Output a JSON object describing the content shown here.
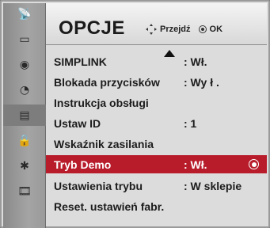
{
  "header": {
    "title": "OPCJE",
    "hint_move": "Przejdź",
    "hint_ok": "OK"
  },
  "sidebar": {
    "items": [
      {
        "icon": "satellite-dish-icon",
        "glyph": "📡"
      },
      {
        "icon": "picture-monitor-icon",
        "glyph": "▭"
      },
      {
        "icon": "audio-speaker-icon",
        "glyph": "◉"
      },
      {
        "icon": "clock-icon",
        "glyph": "◔"
      },
      {
        "icon": "options-toolbox-icon",
        "glyph": "▤"
      },
      {
        "icon": "lock-icon",
        "glyph": "🔒"
      },
      {
        "icon": "bluetooth-icon",
        "glyph": "✱"
      },
      {
        "icon": "media-film-icon",
        "glyph": "🎞"
      }
    ],
    "selected_index": 4
  },
  "menu": {
    "items": [
      {
        "label": "SIMPLINK",
        "value": ": Wł."
      },
      {
        "label": "Blokada przycisków",
        "value": ": Wy ł ."
      },
      {
        "label": "Instrukcja obsługi",
        "value": ""
      },
      {
        "label": "Ustaw ID",
        "value": ": 1"
      },
      {
        "label": "Wskaźnik zasilania",
        "value": ""
      },
      {
        "label": "Tryb Demo",
        "value": ": Wł."
      },
      {
        "label": "Ustawienia trybu",
        "value": ": W sklepie"
      },
      {
        "label": "Reset. ustawień  fabr.",
        "value": ""
      }
    ],
    "selected_index": 5
  },
  "colors": {
    "selection": "#b81c2b",
    "header_bg": "#e8e8e8",
    "sidebar_bg": "#9a9a9a"
  }
}
